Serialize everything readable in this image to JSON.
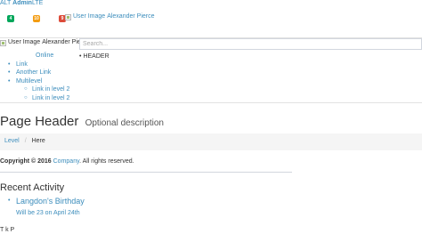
{
  "logo": {
    "prefix": "ALT",
    "main": "Admin",
    "suffix": "LTE"
  },
  "notifications": [
    {
      "count": "4",
      "color": "#00a65a"
    },
    {
      "count": "10",
      "color": "#f39c12"
    },
    {
      "count": "9",
      "color": "#dd4b39"
    }
  ],
  "header_user": {
    "image_alt": "User Image",
    "name": "Alexander Pierce"
  },
  "sidebar_user": {
    "image_alt": "User Image",
    "name": "Alexander Pierce",
    "status": "Online"
  },
  "search": {
    "placeholder": "Search..."
  },
  "menu": {
    "header": "HEADER",
    "items": [
      {
        "label": "Link"
      },
      {
        "label": "Another Link"
      },
      {
        "label": "Multilevel",
        "children": [
          {
            "label": "Link in level 2"
          },
          {
            "label": "Link in level 2"
          }
        ]
      }
    ]
  },
  "page": {
    "title": "Page Header",
    "description": "Optional description"
  },
  "breadcrumb": {
    "level": "Level",
    "separator": "/",
    "current": "Here"
  },
  "footer": {
    "copyright_prefix": "Copyright © 2016",
    "company": "Company",
    "rights": ". All rights reserved."
  },
  "recent_activity": {
    "heading": "Recent Activity",
    "items": [
      {
        "title": "Langdon's Birthday",
        "subtitle": "Will be 23 on April 24th"
      }
    ]
  },
  "bottom_partial": {
    "text": "T  k  P"
  }
}
